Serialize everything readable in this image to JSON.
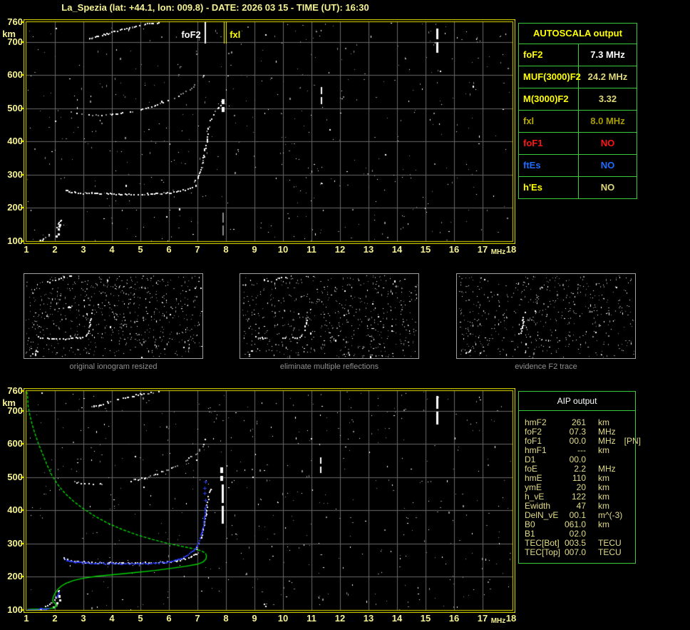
{
  "title": "La_Spezia (lat: +44.1, lon: 009.8) - DATE: 2026 03 15 - TIME (UT): 16:30",
  "colors": {
    "background": "#000000",
    "frame_yellow": "#e6e200",
    "axis_text": "#f5f292",
    "grid": "#686868",
    "table_border": "#3dc93d",
    "bright_yellow": "#ffff00",
    "white": "#ffffff",
    "khaki": "#ded878",
    "dark_yellow": "#a89e00",
    "red": "#ff1414",
    "blue": "#1f6bff",
    "noise_gray": "#8c8c8c",
    "restored_blue": "#2a3cf0",
    "profile_green": "#00d800",
    "caption_gray": "#909090"
  },
  "autoscala_table": {
    "title": "AUTOSCALA output",
    "rows": [
      {
        "label": "foF2",
        "value": "7.3 MHz",
        "lc": "#ffff00",
        "vc": "#ffffff"
      },
      {
        "label": "MUF(3000)F2",
        "value": "24.2 MHz",
        "lc": "#ffff00",
        "vc": "#ded878"
      },
      {
        "label": "M(3000)F2",
        "value": "3.32",
        "lc": "#ffff00",
        "vc": "#ded878"
      },
      {
        "label": "fxl",
        "value": "8.0 MHz",
        "lc": "#b8ae00",
        "vc": "#a89e00"
      },
      {
        "label": "foF1",
        "value": "NO",
        "lc": "#ff1414",
        "vc": "#ff1414"
      },
      {
        "label": "ftEs",
        "value": "NO",
        "lc": "#1f6bff",
        "vc": "#1f6bff"
      },
      {
        "label": "h'Es",
        "value": "NO",
        "lc": "#ffff00",
        "vc": "#ded878"
      }
    ]
  },
  "aip_table": {
    "title": "AIP output",
    "rows": [
      {
        "label": "hmF2",
        "value": "261",
        "unit": "km",
        "extra": ""
      },
      {
        "label": "foF2",
        "value": "07.3",
        "unit": "MHz",
        "extra": ""
      },
      {
        "label": "foF1",
        "value": "00.0",
        "unit": "MHz",
        "extra": "[PN]"
      },
      {
        "label": "hmF1",
        "value": "---",
        "unit": "km",
        "extra": ""
      },
      {
        "label": "D1",
        "value": "00.0",
        "unit": "",
        "extra": ""
      },
      {
        "label": "foE",
        "value": "2.2",
        "unit": "MHz",
        "extra": ""
      },
      {
        "label": "hmE",
        "value": "110",
        "unit": "km",
        "extra": ""
      },
      {
        "label": "ymE",
        "value": "20",
        "unit": "km",
        "extra": ""
      },
      {
        "label": "h_vE",
        "value": "122",
        "unit": "km",
        "extra": ""
      },
      {
        "label": "Ewidth",
        "value": "47",
        "unit": "km",
        "extra": ""
      },
      {
        "label": "DelN_vE",
        "value": "00.1",
        "unit": "m^(-3)",
        "extra": ""
      },
      {
        "label": "B0",
        "value": "061.0",
        "unit": "km",
        "extra": ""
      },
      {
        "label": "B1",
        "value": "02.0",
        "unit": "",
        "extra": ""
      },
      {
        "label": "TEC[Bot]",
        "value": "003.5",
        "unit": "TECU",
        "extra": ""
      },
      {
        "label": "TEC[Top]",
        "value": "007.0",
        "unit": "TECU",
        "extra": ""
      }
    ]
  },
  "chart_data": {
    "type": "scatter",
    "x_axis": {
      "unit": "MHz",
      "ticks": [
        1,
        2,
        3,
        4,
        5,
        6,
        7,
        8,
        9,
        10,
        11,
        12,
        13,
        14,
        15,
        16,
        17,
        18
      ],
      "min": 1,
      "max": 18.05
    },
    "y_axis": {
      "unit": "km",
      "ticks": [
        760,
        700,
        600,
        500,
        400,
        300,
        200,
        100
      ],
      "min": 98,
      "max": 760
    },
    "traces": {
      "f2_flat": [
        [
          2.3,
          258
        ],
        [
          2.45,
          252
        ],
        [
          2.6,
          249
        ],
        [
          2.8,
          247
        ],
        [
          3.0,
          246
        ],
        [
          3.3,
          245
        ],
        [
          3.6,
          244
        ],
        [
          4.0,
          243
        ],
        [
          4.4,
          243
        ],
        [
          4.8,
          243
        ],
        [
          5.2,
          244
        ],
        [
          5.6,
          245
        ],
        [
          6.0,
          247
        ],
        [
          6.3,
          251
        ],
        [
          6.6,
          257
        ],
        [
          6.8,
          264
        ],
        [
          7.0,
          274
        ]
      ],
      "f2_rise": [
        [
          6.9,
          280
        ],
        [
          7.0,
          295
        ],
        [
          7.08,
          312
        ],
        [
          7.15,
          330
        ],
        [
          7.2,
          352
        ],
        [
          7.25,
          378
        ],
        [
          7.3,
          405
        ],
        [
          7.35,
          432
        ],
        [
          7.4,
          455
        ],
        [
          7.45,
          472
        ]
      ],
      "f2_spread": [
        [
          7.5,
          470
        ],
        [
          7.55,
          488
        ],
        [
          7.65,
          498
        ],
        [
          7.75,
          505
        ],
        [
          7.85,
          512
        ],
        [
          7.9,
          520
        ]
      ],
      "hop2": [
        [
          2.55,
          490
        ],
        [
          2.8,
          486
        ],
        [
          3.1,
          483
        ],
        [
          3.5,
          482
        ],
        [
          3.9,
          483
        ],
        [
          4.3,
          486
        ],
        [
          4.7,
          492
        ],
        [
          5.1,
          500
        ],
        [
          5.5,
          510
        ],
        [
          5.9,
          522
        ],
        [
          6.3,
          538
        ],
        [
          6.7,
          558
        ],
        [
          7.0,
          578
        ],
        [
          7.2,
          600
        ],
        [
          7.3,
          620
        ]
      ],
      "hop3": [
        [
          3.2,
          712
        ],
        [
          3.5,
          719
        ],
        [
          3.8,
          727
        ],
        [
          4.1,
          734
        ],
        [
          4.5,
          742
        ],
        [
          4.9,
          750
        ],
        [
          5.3,
          756
        ],
        [
          5.7,
          760
        ]
      ],
      "e_region": [
        [
          1.45,
          103
        ],
        [
          1.55,
          107
        ],
        [
          1.65,
          112
        ],
        [
          1.75,
          117
        ],
        [
          1.85,
          122
        ],
        [
          1.95,
          128
        ],
        [
          2.0,
          135
        ],
        [
          2.05,
          143
        ],
        [
          2.1,
          152
        ],
        [
          2.15,
          162
        ],
        [
          2.2,
          170
        ]
      ],
      "e_blob": [
        [
          1.95,
          112
        ],
        [
          2.05,
          120
        ],
        [
          2.15,
          132
        ],
        [
          2.1,
          143
        ],
        [
          2.2,
          155
        ]
      ],
      "restored_trace": [
        [
          2.35,
          253
        ],
        [
          2.5,
          249
        ],
        [
          2.65,
          247
        ],
        [
          2.85,
          245
        ],
        [
          3.1,
          244
        ],
        [
          3.4,
          243
        ],
        [
          3.7,
          242
        ],
        [
          4.0,
          242
        ],
        [
          4.3,
          241
        ],
        [
          4.6,
          241
        ],
        [
          4.9,
          241
        ],
        [
          5.2,
          242
        ],
        [
          5.5,
          243
        ],
        [
          5.8,
          245
        ],
        [
          6.0,
          248
        ],
        [
          6.2,
          252
        ],
        [
          6.4,
          258
        ],
        [
          6.6,
          266
        ],
        [
          6.8,
          277
        ],
        [
          6.95,
          292
        ],
        [
          7.05,
          310
        ],
        [
          7.12,
          330
        ],
        [
          7.18,
          352
        ],
        [
          7.22,
          375
        ],
        [
          7.25,
          398
        ],
        [
          7.27,
          420
        ]
      ],
      "restored_e": [
        [
          1.02,
          103
        ],
        [
          1.12,
          103
        ],
        [
          1.22,
          103
        ],
        [
          1.32,
          103
        ],
        [
          1.42,
          104
        ],
        [
          1.52,
          104
        ],
        [
          1.62,
          105
        ],
        [
          1.72,
          106
        ],
        [
          1.8,
          108
        ]
      ],
      "restored_e2": [
        [
          2.05,
          140
        ],
        [
          2.1,
          150
        ],
        [
          2.15,
          158
        ]
      ],
      "blue_plus": [
        [
          7.27,
          432
        ],
        [
          7.26,
          452
        ],
        [
          7.24,
          468
        ],
        [
          7.28,
          488
        ]
      ],
      "profile": [
        [
          1.02,
          758
        ],
        [
          1.04,
          745
        ],
        [
          1.06,
          715
        ],
        [
          1.12,
          688
        ],
        [
          1.2,
          660
        ],
        [
          1.3,
          632
        ],
        [
          1.42,
          602
        ],
        [
          1.56,
          572
        ],
        [
          1.72,
          538
        ],
        [
          1.9,
          505
        ],
        [
          2.1,
          478
        ],
        [
          2.35,
          452
        ],
        [
          2.65,
          428
        ],
        [
          3.0,
          405
        ],
        [
          3.4,
          383
        ],
        [
          3.85,
          362
        ],
        [
          4.35,
          343
        ],
        [
          4.9,
          326
        ],
        [
          5.45,
          312
        ],
        [
          6.0,
          300
        ],
        [
          6.5,
          291
        ],
        [
          6.9,
          284
        ],
        [
          7.15,
          278
        ],
        [
          7.28,
          271
        ],
        [
          7.32,
          263
        ],
        [
          7.3,
          254
        ],
        [
          7.2,
          245
        ],
        [
          7.0,
          238
        ],
        [
          6.6,
          232
        ],
        [
          6.1,
          226
        ],
        [
          5.5,
          219
        ],
        [
          4.8,
          213
        ],
        [
          4.1,
          207
        ],
        [
          3.5,
          202
        ],
        [
          3.0,
          196
        ],
        [
          2.65,
          189
        ],
        [
          2.4,
          181
        ],
        [
          2.22,
          172
        ],
        [
          2.1,
          162
        ],
        [
          2.0,
          150
        ],
        [
          1.94,
          138
        ],
        [
          1.92,
          128
        ],
        [
          1.96,
          123
        ],
        [
          2.04,
          118
        ],
        [
          2.06,
          112
        ],
        [
          1.99,
          107
        ],
        [
          1.86,
          105
        ],
        [
          1.65,
          104
        ],
        [
          1.4,
          103
        ],
        [
          1.15,
          102
        ],
        [
          1.03,
          101
        ]
      ]
    },
    "plots": {
      "top": {
        "markers": [
          {
            "label": "foF2",
            "f": 7.27,
            "color": "#ffffff",
            "style": "single"
          },
          {
            "label": "fxl",
            "f": 7.98,
            "color": "#ffff00",
            "style": "double"
          }
        ],
        "white_traces": [
          "f2_flat",
          "f2_rise",
          "f2_spread",
          "hop2",
          "hop3",
          "e_region",
          "e_blob"
        ],
        "interference": [
          {
            "f": 15.4,
            "km": [
              668,
              740
            ],
            "w": 3
          },
          {
            "f": 11.35,
            "km": [
              512,
              565
            ],
            "w": 2
          },
          {
            "f": 7.89,
            "km": [
              490,
              528
            ],
            "w": 4
          },
          {
            "f": 7.9,
            "km": [
              118,
              185
            ],
            "w": 2,
            "gray": true
          }
        ],
        "noise_seed": 7,
        "noise_count": 500
      },
      "bottom": {
        "markers": [],
        "white_traces": [
          "f2_flat",
          "f2_rise",
          "hop2",
          "hop3",
          "e_region",
          "e_blob"
        ],
        "interference": [
          {
            "f": 15.4,
            "km": [
              660,
              745
            ],
            "w": 3
          },
          {
            "f": 11.33,
            "km": [
              512,
              560
            ],
            "w": 2
          },
          {
            "f": 7.89,
            "km": [
              360,
              478
            ],
            "w": 3
          },
          {
            "f": 7.85,
            "km": [
              490,
              530
            ],
            "w": 4
          }
        ],
        "restored": [
          "restored_trace",
          "restored_e",
          "restored_e2"
        ],
        "plus_points": "blue_plus",
        "profile": "profile",
        "noise_seed": 13,
        "noise_count": 500
      },
      "panels": [
        {
          "caption": "original ionogram resized",
          "traces": [
            "hop3",
            "hop2",
            "f2_flat",
            "f2_rise",
            "e_region",
            "e_blob"
          ],
          "noise_seed": 21,
          "noise_count": 640
        },
        {
          "caption": "eliminate multiple reflections",
          "traces": [
            "hop3",
            "f2_flat",
            "f2_rise",
            "e_region",
            "e_blob"
          ],
          "noise_seed": 33,
          "noise_count": 580
        },
        {
          "caption": "evidence F2 trace",
          "traces": [
            "f2_rise",
            "e_region",
            "e_blob"
          ],
          "noise_seed": 45,
          "noise_count": 520
        }
      ]
    }
  }
}
